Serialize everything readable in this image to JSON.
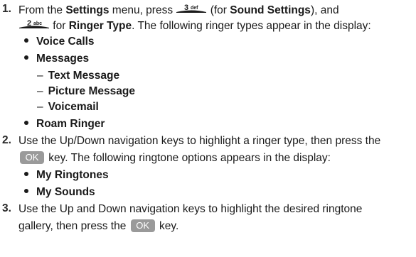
{
  "step1": {
    "num": "1.",
    "l1_a": "From the ",
    "l1_settings": "Settings",
    "l1_b": " menu, press ",
    "l1_c": " (for ",
    "l1_sound": "Sound Settings",
    "l1_d": "), and",
    "l2_a": " for ",
    "l2_ringer": "Ringer Type",
    "l2_b": ". The following ringer types appear in the display:",
    "items": {
      "voice": "Voice Calls",
      "messages": "Messages",
      "text": "Text Message",
      "picture": "Picture Message",
      "voicemail": "Voicemail",
      "roam": "Roam Ringer"
    }
  },
  "step2": {
    "num": "2.",
    "l1": "Use the Up/Down navigation keys to highlight a ringer type, then press the",
    "l2": " key. The following ringtone options appears in the display:",
    "items": {
      "ringtones": "My Ringtones",
      "sounds": "My Sounds"
    }
  },
  "step3": {
    "num": "3.",
    "l1": "Use the Up and Down navigation keys to highlight the desired ringtone",
    "l2_a": "gallery, then press the ",
    "l2_b": " key."
  },
  "keys": {
    "key3_label": "3 def",
    "key2_label": "2 abc",
    "ok_label": "OK"
  },
  "dash_glyph": "–"
}
